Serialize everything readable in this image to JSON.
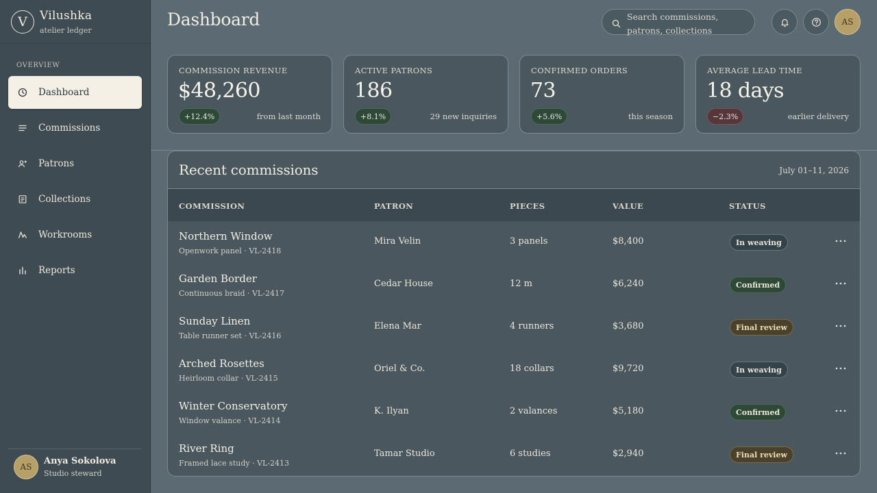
{
  "brand": {
    "initial": "V",
    "name": "Vilushka",
    "subtitle": "atelier ledger"
  },
  "sidebar": {
    "section_label": "OVERVIEW",
    "items": [
      {
        "label": "Dashboard",
        "icon": "clock-icon",
        "active": true
      },
      {
        "label": "Commissions",
        "icon": "list-icon",
        "active": false
      },
      {
        "label": "Patrons",
        "icon": "user-plus-icon",
        "active": false
      },
      {
        "label": "Collections",
        "icon": "document-icon",
        "active": false
      },
      {
        "label": "Workrooms",
        "icon": "activity-icon",
        "active": false
      },
      {
        "label": "Reports",
        "icon": "bar-chart-icon",
        "active": false
      }
    ],
    "user": {
      "initials": "AS",
      "name": "Anya Sokolova",
      "role": "Studio steward"
    }
  },
  "header": {
    "title": "Dashboard",
    "search_placeholder": "Search commissions, patrons, collections",
    "avatar_initials": "AS"
  },
  "stats": [
    {
      "label": "COMMISSION REVENUE",
      "value": "$48,260",
      "change": "+12.4%",
      "trend": "up",
      "note": "from last month"
    },
    {
      "label": "ACTIVE PATRONS",
      "value": "186",
      "change": "+8.1%",
      "trend": "up",
      "note": "29 new inquiries"
    },
    {
      "label": "CONFIRMED ORDERS",
      "value": "73",
      "change": "+5.6%",
      "trend": "up",
      "note": "this season"
    },
    {
      "label": "AVERAGE LEAD TIME",
      "value": "18 days",
      "change": "−2.3%",
      "trend": "down",
      "note": "earlier delivery"
    }
  ],
  "recent": {
    "title": "Recent commissions",
    "date_range": "July 01–11, 2026",
    "columns": [
      "COMMISSION",
      "PATRON",
      "PIECES",
      "VALUE",
      "STATUS"
    ],
    "rows": [
      {
        "name": "Northern Window",
        "sub": "Openwork panel · VL-2418",
        "patron": "Mira Velin",
        "pieces": "3 panels",
        "value": "$8,400",
        "status": "In weaving",
        "status_kind": "weaving"
      },
      {
        "name": "Garden Border",
        "sub": "Continuous braid · VL-2417",
        "patron": "Cedar House",
        "pieces": "12 m",
        "value": "$6,240",
        "status": "Confirmed",
        "status_kind": "confirmed"
      },
      {
        "name": "Sunday Linen",
        "sub": "Table runner set · VL-2416",
        "patron": "Elena Mar",
        "pieces": "4 runners",
        "value": "$3,680",
        "status": "Final review",
        "status_kind": "review"
      },
      {
        "name": "Arched Rosettes",
        "sub": "Heirloom collar · VL-2415",
        "patron": "Oriel & Co.",
        "pieces": "18 collars",
        "value": "$9,720",
        "status": "In weaving",
        "status_kind": "weaving"
      },
      {
        "name": "Winter Conservatory",
        "sub": "Window valance · VL-2414",
        "patron": "K. Ilyan",
        "pieces": "2 valances",
        "value": "$5,180",
        "status": "Confirmed",
        "status_kind": "confirmed"
      },
      {
        "name": "River Ring",
        "sub": "Framed lace study · VL-2413",
        "patron": "Tamar Studio",
        "pieces": "6 studies",
        "value": "$2,940",
        "status": "Final review",
        "status_kind": "review"
      }
    ]
  },
  "colors": {
    "background": "#5b6a73",
    "sidebar": "#3f4b52",
    "card": "#4a575e",
    "active_nav": "#f4f0e6",
    "avatar": "#b79f68",
    "positive_badge": "#2f4939",
    "negative_badge": "#55363a",
    "review_badge": "#4a412d"
  }
}
